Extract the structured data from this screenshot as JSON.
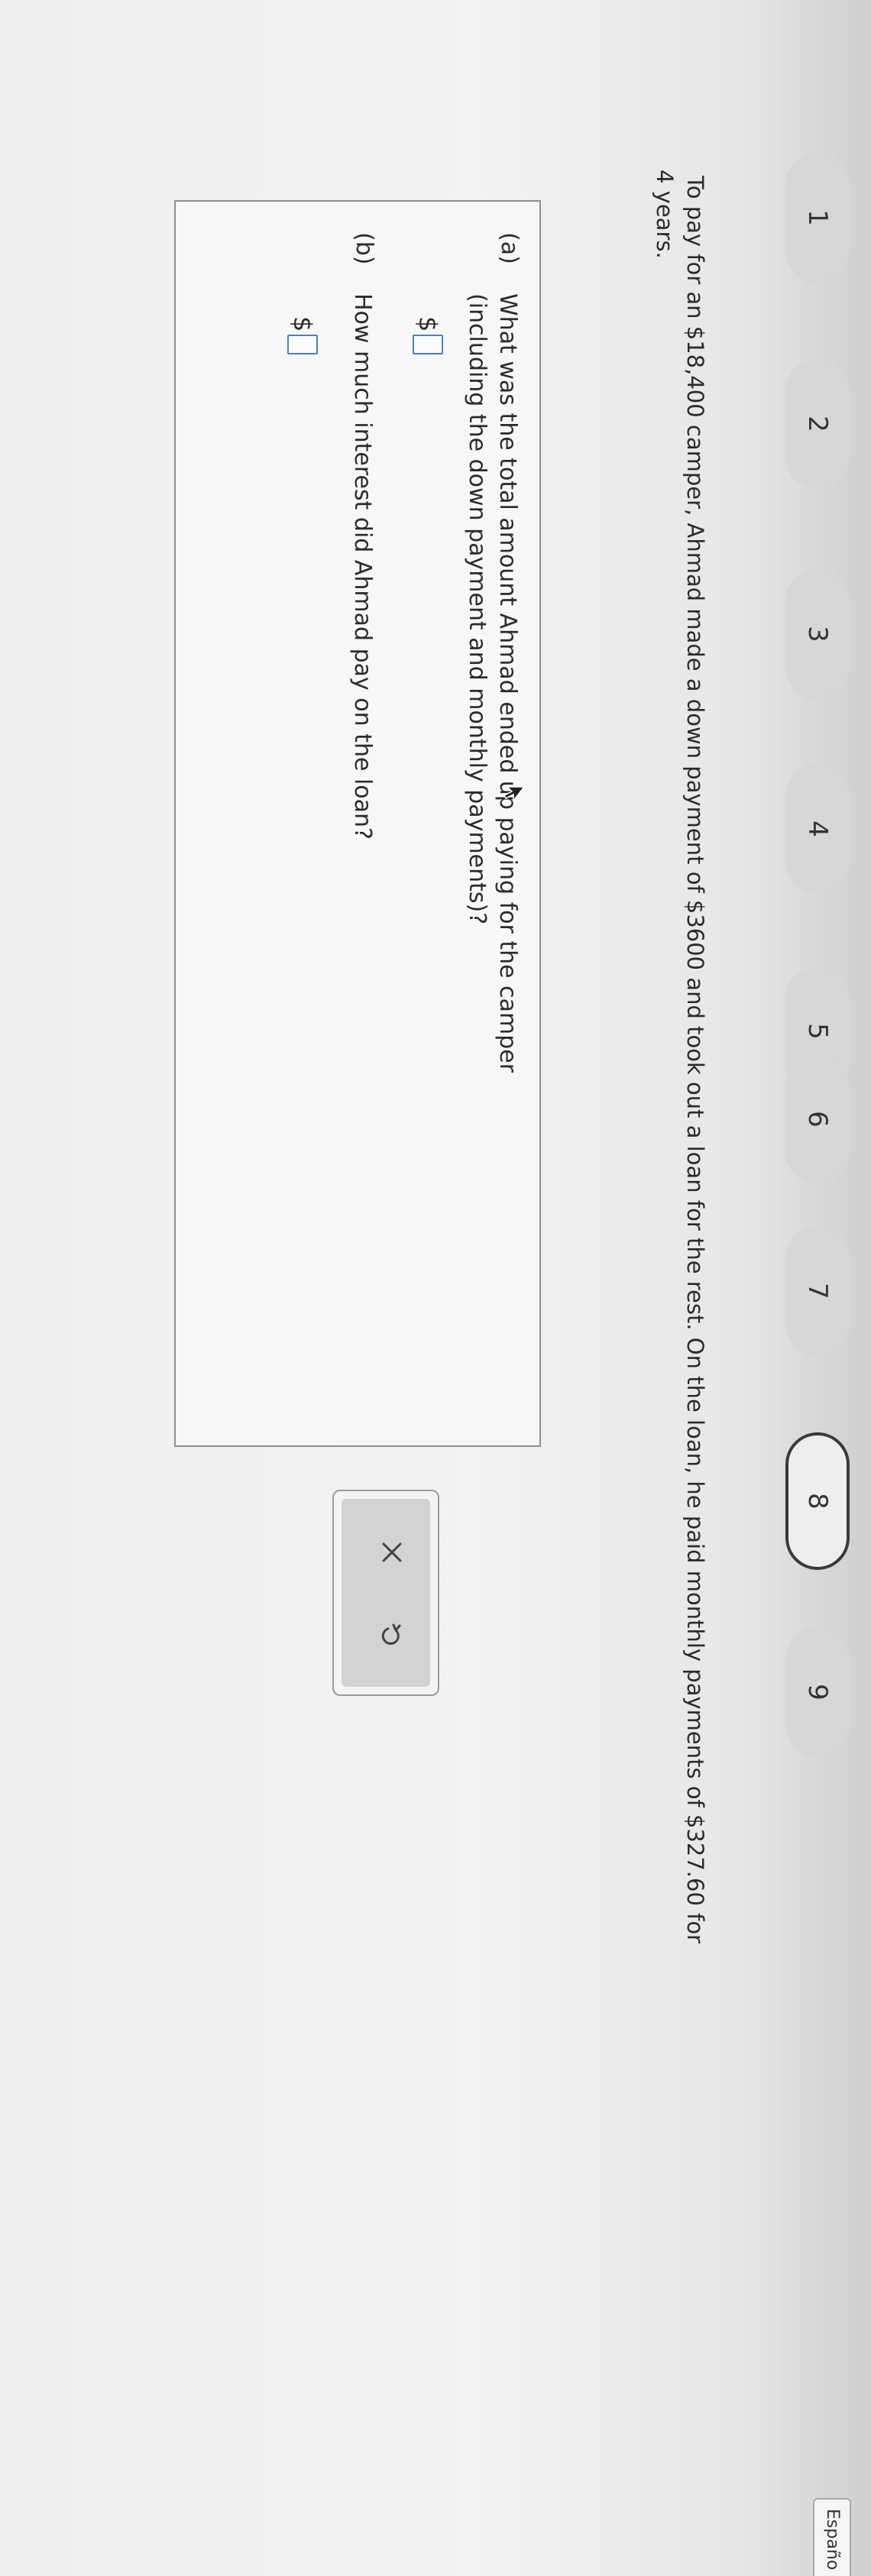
{
  "nav": {
    "steps": [
      {
        "label": "1",
        "active": false
      },
      {
        "label": "2",
        "active": false
      },
      {
        "label": "3",
        "active": false
      },
      {
        "label": "4",
        "active": false
      },
      {
        "label": "5",
        "active": false
      },
      {
        "label": "6",
        "active": false
      },
      {
        "label": "7",
        "active": false
      },
      {
        "label": "8",
        "active": true
      },
      {
        "label": "9",
        "active": false
      }
    ],
    "language_link": "Españo"
  },
  "problem": {
    "line1": "To pay for an $18,400 camper, Ahmad made a down payment of $3600 and took out a loan for the rest. On the loan, he paid monthly payments of $327.60 for",
    "line2": "4 years."
  },
  "question": {
    "part_a": {
      "label": "(a)",
      "line1": "What was the total amount Ahmad ended up paying for the camper",
      "line2": "(including the down payment and monthly payments)?",
      "currency": "$",
      "value": ""
    },
    "part_b": {
      "label": "(b)",
      "text": "How much interest did Ahmad pay on the loan?",
      "currency": "$",
      "value": ""
    }
  },
  "tools": {
    "clear_icon": "x-icon",
    "undo_icon": "undo-icon"
  },
  "colors": {
    "input_border": "#4c7fc0",
    "active_step_border": "#3a3a3a",
    "pill_bg": "#d7d7d7"
  }
}
